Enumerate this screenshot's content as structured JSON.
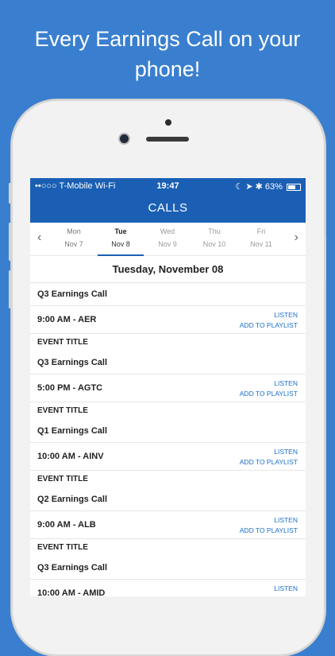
{
  "headline": {
    "line1": "Every Earnings Call on your",
    "line2": "phone!"
  },
  "status": {
    "carrier": "••○○○ T-Mobile Wi-Fi",
    "time": "19:47",
    "icons": "☾ ➤ ✱",
    "battery": "63%",
    "battery_level": 0.63
  },
  "nav": {
    "title": "CALLS"
  },
  "dates": [
    {
      "day": "Mon",
      "date": "Nov 7"
    },
    {
      "day": "Tue",
      "date": "Nov 8"
    },
    {
      "day": "Wed",
      "date": "Nov 9"
    },
    {
      "day": "Thu",
      "date": "Nov 10"
    },
    {
      "day": "Fri",
      "date": "Nov 11"
    }
  ],
  "day_title": "Tuesday, November 08",
  "first_title": "Q3 Earnings Call",
  "event_label": "EVENT TITLE",
  "actions": {
    "listen": "LISTEN",
    "add": "ADD TO PLAYLIST"
  },
  "calls": [
    {
      "time": "9:00 AM - AER",
      "next_title": "Q3 Earnings Call"
    },
    {
      "time": "5:00 PM - AGTC",
      "next_title": "Q1 Earnings Call"
    },
    {
      "time": "10:00 AM - AINV",
      "next_title": "Q2 Earnings Call"
    },
    {
      "time": "9:00 AM - ALB",
      "next_title": "Q3 Earnings Call"
    },
    {
      "time": "10:00 AM - AMID",
      "next_title": ""
    }
  ]
}
